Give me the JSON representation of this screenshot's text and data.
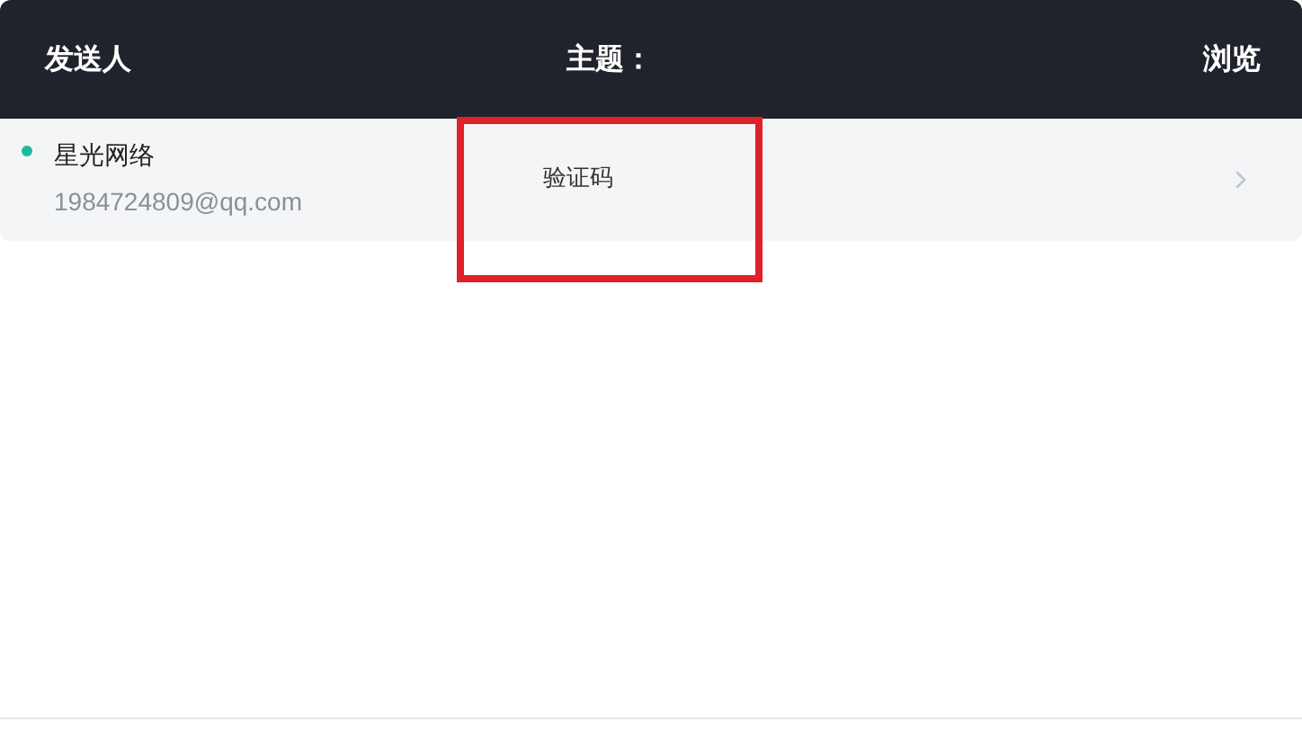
{
  "header": {
    "columns": [
      "发送人",
      "主题：",
      "浏览"
    ]
  },
  "messages": [
    {
      "sender": "星光网络",
      "email": "1984724809@qq.com",
      "subject": "验证码",
      "unread": true,
      "color": "#1abc9c"
    }
  ]
}
